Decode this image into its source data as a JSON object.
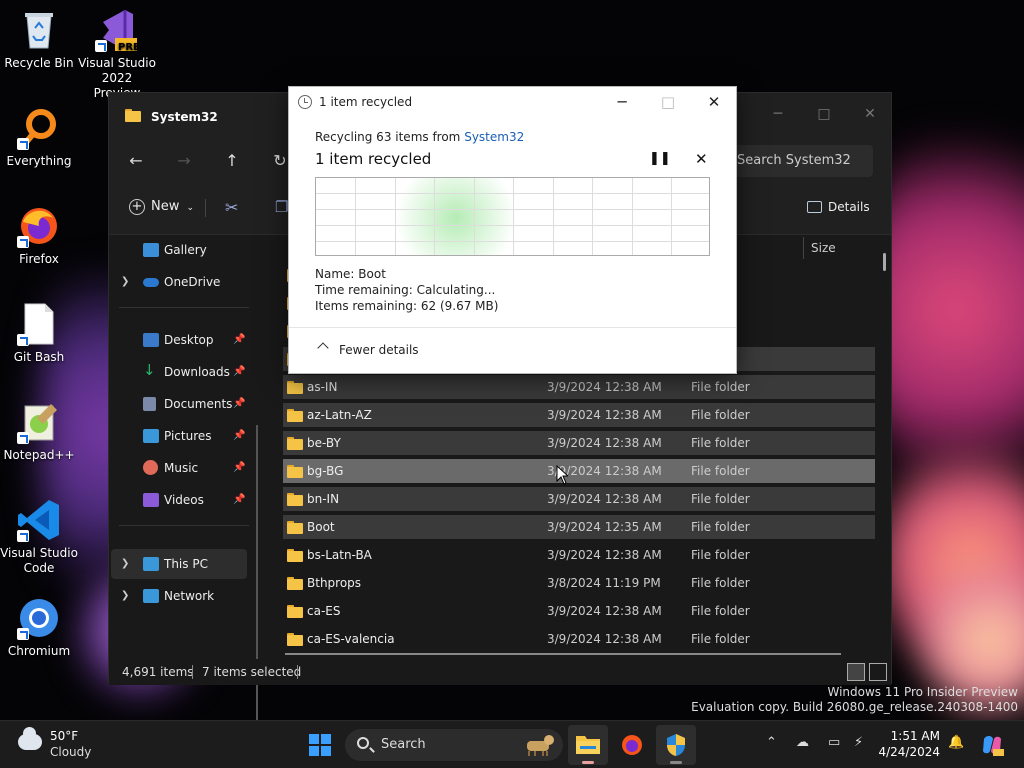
{
  "desktop": {
    "icons": [
      {
        "label": "Recycle Bin",
        "icon": "recycle-bin-icon"
      },
      {
        "label": "Visual Studio 2022 Preview",
        "icon": "visual-studio-preview-icon",
        "badge": "PRE"
      },
      {
        "label": "Everything",
        "icon": "everything-search-icon"
      },
      {
        "label": "Firefox",
        "icon": "firefox-icon"
      },
      {
        "label": "Git Bash",
        "icon": "git-bash-icon"
      },
      {
        "label": "Notepad++",
        "icon": "notepad-plus-plus-icon"
      },
      {
        "label": "Visual Studio Code",
        "icon": "vscode-icon"
      },
      {
        "label": "Chromium",
        "icon": "chromium-icon"
      }
    ]
  },
  "explorer": {
    "title": "System32",
    "search_placeholder": "Search System32",
    "toolbar": {
      "new_label": "New",
      "details_label": "Details"
    },
    "column_size": "Size",
    "sidebar": [
      {
        "label": "Gallery",
        "icon": "gallery-icon",
        "color": "#3a8fd8"
      },
      {
        "label": "OneDrive",
        "icon": "onedrive-icon",
        "color": "#2a78d0"
      },
      {
        "label": "Desktop",
        "icon": "desktop-icon",
        "color": "#3a7ac8"
      },
      {
        "label": "Downloads",
        "icon": "downloads-icon",
        "color": "#2ab46a"
      },
      {
        "label": "Documents",
        "icon": "documents-icon",
        "color": "#7a8aa8"
      },
      {
        "label": "Pictures",
        "icon": "pictures-icon",
        "color": "#3a98d8"
      },
      {
        "label": "Music",
        "icon": "music-icon",
        "color": "#e06a5a"
      },
      {
        "label": "Videos",
        "icon": "videos-icon",
        "color": "#8a5ad8"
      },
      {
        "label": "This PC",
        "icon": "this-pc-icon",
        "color": "#3a98d8"
      },
      {
        "label": "Network",
        "icon": "network-icon",
        "color": "#3a98d8"
      }
    ],
    "partial_rows": [
      "folder",
      "folder",
      "folder",
      "folder"
    ],
    "partial_type": "folder",
    "rows": [
      {
        "name": "as-IN",
        "date": "3/9/2024 12:38 AM",
        "type": "File folder",
        "state": "sel"
      },
      {
        "name": "az-Latn-AZ",
        "date": "3/9/2024 12:38 AM",
        "type": "File folder",
        "state": "sel"
      },
      {
        "name": "be-BY",
        "date": "3/9/2024 12:38 AM",
        "type": "File folder",
        "state": "sel"
      },
      {
        "name": "bg-BG",
        "date": "3/9/2024 12:38 AM",
        "type": "File folder",
        "state": "hover"
      },
      {
        "name": "bn-IN",
        "date": "3/9/2024 12:38 AM",
        "type": "File folder",
        "state": "sel"
      },
      {
        "name": "Boot",
        "date": "3/9/2024 12:35 AM",
        "type": "File folder",
        "state": "sel"
      },
      {
        "name": "bs-Latn-BA",
        "date": "3/9/2024 12:38 AM",
        "type": "File folder",
        "state": "none"
      },
      {
        "name": "Bthprops",
        "date": "3/8/2024 11:19 PM",
        "type": "File folder",
        "state": "none"
      },
      {
        "name": "ca-ES",
        "date": "3/9/2024 12:38 AM",
        "type": "File folder",
        "state": "none"
      },
      {
        "name": "ca-ES-valencia",
        "date": "3/9/2024 12:38 AM",
        "type": "File folder",
        "state": "none"
      }
    ],
    "status": {
      "items": "4,691 items",
      "selected": "7 items selected"
    }
  },
  "dialog": {
    "title": "1 item recycled",
    "recycling_prefix": "Recycling 63 items from",
    "recycling_source": "System32",
    "headline": "1 item recycled",
    "name_label": "Name:",
    "name_value": "Boot",
    "time_label": "Time remaining:",
    "time_value": "Calculating...",
    "items_label": "Items remaining:",
    "items_value": "62 (9.67 MB)",
    "fewer_details": "Fewer details"
  },
  "watermark": {
    "line1": "Windows 11 Pro Insider Preview",
    "line2": "Evaluation copy. Build 26080.ge_release.240308-1400"
  },
  "taskbar": {
    "weather_temp": "50°F",
    "weather_desc": "Cloudy",
    "search_label": "Search",
    "time": "1:51 AM",
    "date": "4/24/2024"
  }
}
